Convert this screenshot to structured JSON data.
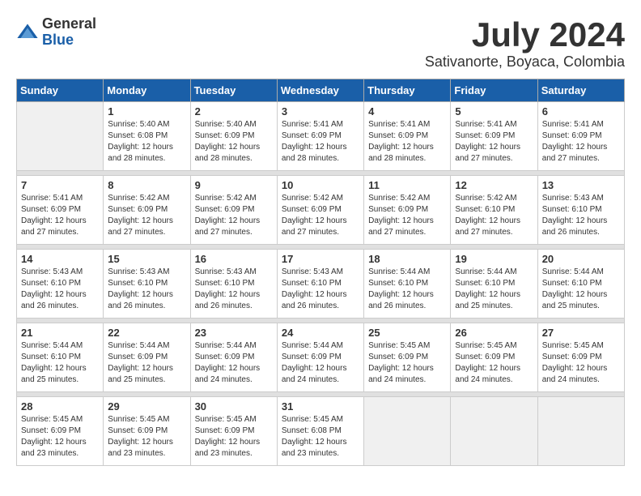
{
  "header": {
    "logo_general": "General",
    "logo_blue": "Blue",
    "title": "July 2024",
    "subtitle": "Sativanorte, Boyaca, Colombia"
  },
  "weekdays": [
    "Sunday",
    "Monday",
    "Tuesday",
    "Wednesday",
    "Thursday",
    "Friday",
    "Saturday"
  ],
  "weeks": [
    [
      {
        "day": "",
        "info": ""
      },
      {
        "day": "1",
        "info": "Sunrise: 5:40 AM\nSunset: 6:08 PM\nDaylight: 12 hours\nand 28 minutes."
      },
      {
        "day": "2",
        "info": "Sunrise: 5:40 AM\nSunset: 6:09 PM\nDaylight: 12 hours\nand 28 minutes."
      },
      {
        "day": "3",
        "info": "Sunrise: 5:41 AM\nSunset: 6:09 PM\nDaylight: 12 hours\nand 28 minutes."
      },
      {
        "day": "4",
        "info": "Sunrise: 5:41 AM\nSunset: 6:09 PM\nDaylight: 12 hours\nand 28 minutes."
      },
      {
        "day": "5",
        "info": "Sunrise: 5:41 AM\nSunset: 6:09 PM\nDaylight: 12 hours\nand 27 minutes."
      },
      {
        "day": "6",
        "info": "Sunrise: 5:41 AM\nSunset: 6:09 PM\nDaylight: 12 hours\nand 27 minutes."
      }
    ],
    [
      {
        "day": "7",
        "info": "Sunrise: 5:41 AM\nSunset: 6:09 PM\nDaylight: 12 hours\nand 27 minutes."
      },
      {
        "day": "8",
        "info": "Sunrise: 5:42 AM\nSunset: 6:09 PM\nDaylight: 12 hours\nand 27 minutes."
      },
      {
        "day": "9",
        "info": "Sunrise: 5:42 AM\nSunset: 6:09 PM\nDaylight: 12 hours\nand 27 minutes."
      },
      {
        "day": "10",
        "info": "Sunrise: 5:42 AM\nSunset: 6:09 PM\nDaylight: 12 hours\nand 27 minutes."
      },
      {
        "day": "11",
        "info": "Sunrise: 5:42 AM\nSunset: 6:09 PM\nDaylight: 12 hours\nand 27 minutes."
      },
      {
        "day": "12",
        "info": "Sunrise: 5:42 AM\nSunset: 6:10 PM\nDaylight: 12 hours\nand 27 minutes."
      },
      {
        "day": "13",
        "info": "Sunrise: 5:43 AM\nSunset: 6:10 PM\nDaylight: 12 hours\nand 26 minutes."
      }
    ],
    [
      {
        "day": "14",
        "info": "Sunrise: 5:43 AM\nSunset: 6:10 PM\nDaylight: 12 hours\nand 26 minutes."
      },
      {
        "day": "15",
        "info": "Sunrise: 5:43 AM\nSunset: 6:10 PM\nDaylight: 12 hours\nand 26 minutes."
      },
      {
        "day": "16",
        "info": "Sunrise: 5:43 AM\nSunset: 6:10 PM\nDaylight: 12 hours\nand 26 minutes."
      },
      {
        "day": "17",
        "info": "Sunrise: 5:43 AM\nSunset: 6:10 PM\nDaylight: 12 hours\nand 26 minutes."
      },
      {
        "day": "18",
        "info": "Sunrise: 5:44 AM\nSunset: 6:10 PM\nDaylight: 12 hours\nand 26 minutes."
      },
      {
        "day": "19",
        "info": "Sunrise: 5:44 AM\nSunset: 6:10 PM\nDaylight: 12 hours\nand 25 minutes."
      },
      {
        "day": "20",
        "info": "Sunrise: 5:44 AM\nSunset: 6:10 PM\nDaylight: 12 hours\nand 25 minutes."
      }
    ],
    [
      {
        "day": "21",
        "info": "Sunrise: 5:44 AM\nSunset: 6:10 PM\nDaylight: 12 hours\nand 25 minutes."
      },
      {
        "day": "22",
        "info": "Sunrise: 5:44 AM\nSunset: 6:09 PM\nDaylight: 12 hours\nand 25 minutes."
      },
      {
        "day": "23",
        "info": "Sunrise: 5:44 AM\nSunset: 6:09 PM\nDaylight: 12 hours\nand 24 minutes."
      },
      {
        "day": "24",
        "info": "Sunrise: 5:44 AM\nSunset: 6:09 PM\nDaylight: 12 hours\nand 24 minutes."
      },
      {
        "day": "25",
        "info": "Sunrise: 5:45 AM\nSunset: 6:09 PM\nDaylight: 12 hours\nand 24 minutes."
      },
      {
        "day": "26",
        "info": "Sunrise: 5:45 AM\nSunset: 6:09 PM\nDaylight: 12 hours\nand 24 minutes."
      },
      {
        "day": "27",
        "info": "Sunrise: 5:45 AM\nSunset: 6:09 PM\nDaylight: 12 hours\nand 24 minutes."
      }
    ],
    [
      {
        "day": "28",
        "info": "Sunrise: 5:45 AM\nSunset: 6:09 PM\nDaylight: 12 hours\nand 23 minutes."
      },
      {
        "day": "29",
        "info": "Sunrise: 5:45 AM\nSunset: 6:09 PM\nDaylight: 12 hours\nand 23 minutes."
      },
      {
        "day": "30",
        "info": "Sunrise: 5:45 AM\nSunset: 6:09 PM\nDaylight: 12 hours\nand 23 minutes."
      },
      {
        "day": "31",
        "info": "Sunrise: 5:45 AM\nSunset: 6:08 PM\nDaylight: 12 hours\nand 23 minutes."
      },
      {
        "day": "",
        "info": ""
      },
      {
        "day": "",
        "info": ""
      },
      {
        "day": "",
        "info": ""
      }
    ]
  ]
}
